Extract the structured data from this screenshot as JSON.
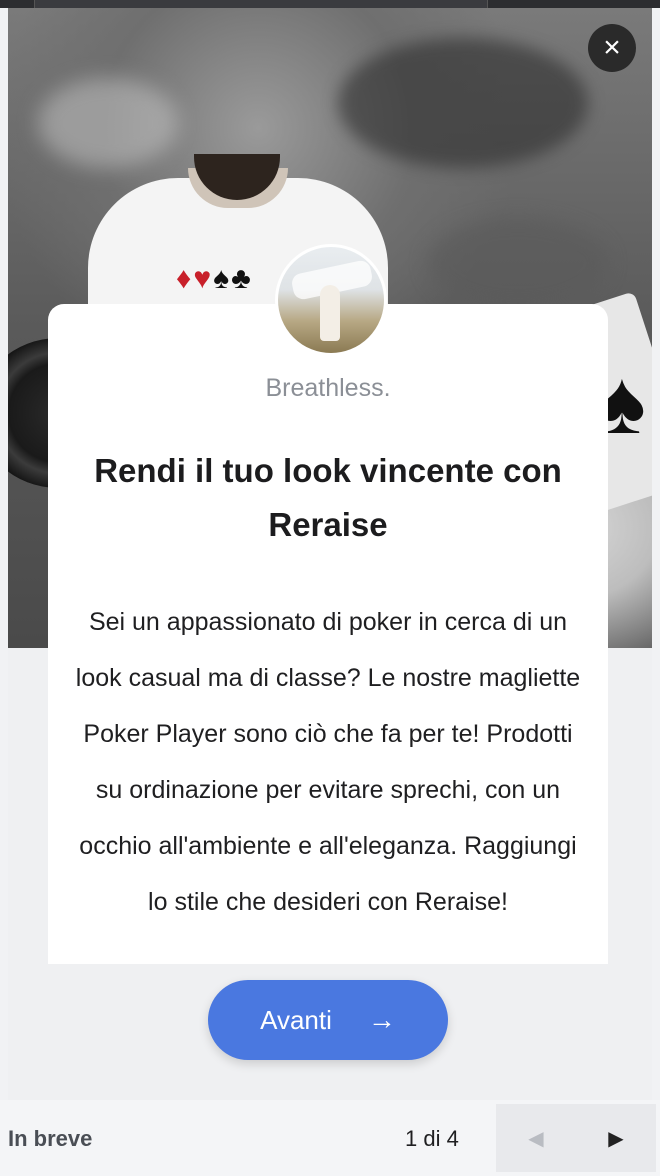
{
  "story": {
    "close_icon": "×",
    "brand_name": "Breathless.",
    "headline": "Rendi il tuo look vincente con Reraise",
    "body": "Sei un appassionato di poker in cerca di un look casual ma di classe? Le nostre magliette Poker Player sono ciò che fa per te! Prodotti su ordinazione per evitare sprechi, con un occhio all'ambiente e all'eleganza. Raggiungi lo stile che desideri con Reraise!",
    "next_button_label": "Avanti",
    "next_icon": "→",
    "suits": {
      "diamond": "♦",
      "heart": "♥",
      "spade": "♠",
      "club": "♣"
    }
  },
  "footer": {
    "section_label": "In breve",
    "pager_text": "1 di 4",
    "prev_icon": "◀",
    "next_icon": "▶"
  },
  "colors": {
    "accent": "#4a78e0",
    "card_bg": "#ffffff",
    "panel_bg": "#eff0f2"
  }
}
